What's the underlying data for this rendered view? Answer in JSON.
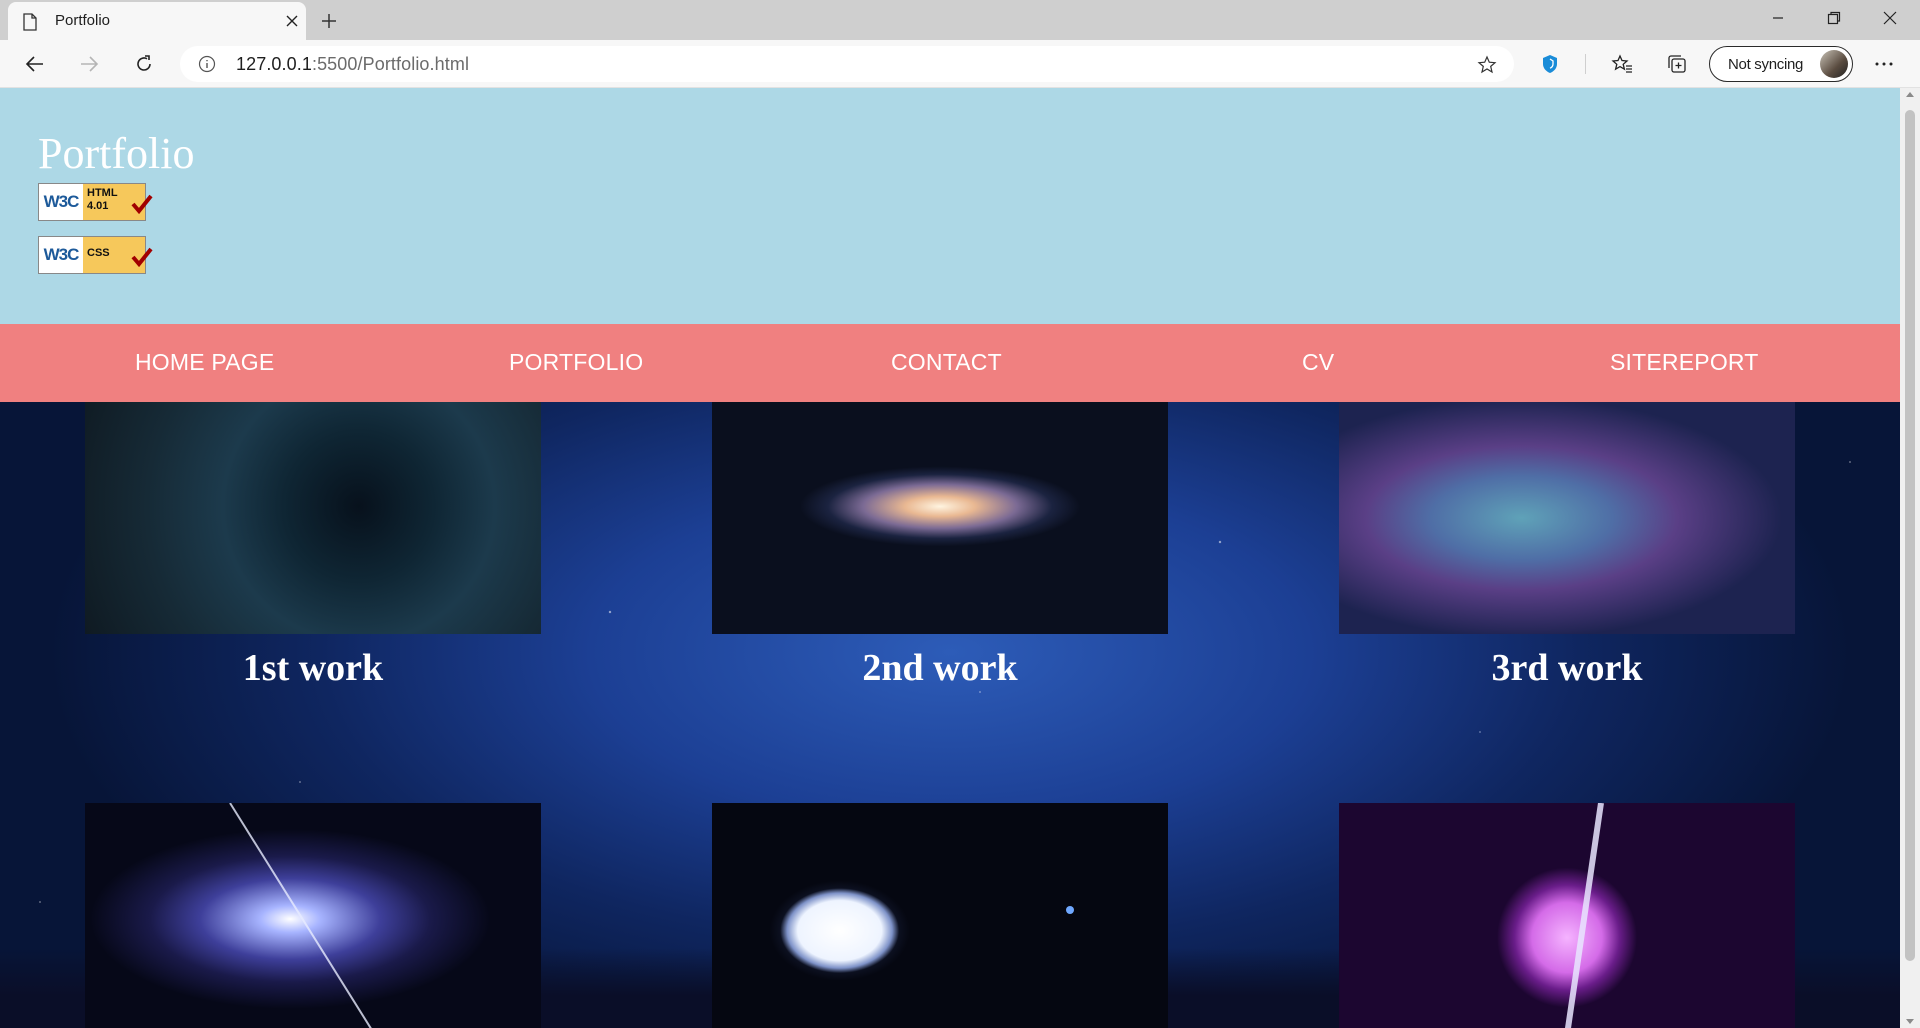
{
  "browser": {
    "tab_title": "Portfolio",
    "url_host": "127.0.0.1",
    "url_rest": ":5500/Portfolio.html",
    "sync_label": "Not syncing"
  },
  "page": {
    "site_title": "Portfolio",
    "badges": [
      {
        "logo": "W3C",
        "text": "HTML\n4.01"
      },
      {
        "logo": "W3C",
        "text": "CSS"
      }
    ],
    "nav": [
      {
        "label": "HOME PAGE"
      },
      {
        "label": "PORTFOLIO"
      },
      {
        "label": "CONTACT"
      },
      {
        "label": "CV"
      },
      {
        "label": "SITEREPORT"
      }
    ],
    "works": [
      {
        "caption": "1st work",
        "image": "dark-vortex"
      },
      {
        "caption": "2nd work",
        "image": "andromeda-galaxy"
      },
      {
        "caption": "3rd work",
        "image": "purple-nebula"
      },
      {
        "caption": "",
        "image": "spiral-galaxy-jet"
      },
      {
        "caption": "",
        "image": "white-star"
      },
      {
        "caption": "",
        "image": "pink-pulsar"
      }
    ]
  },
  "colors": {
    "header_bg": "#add8e6",
    "nav_bg": "#f08080",
    "text": "#ffffff"
  }
}
